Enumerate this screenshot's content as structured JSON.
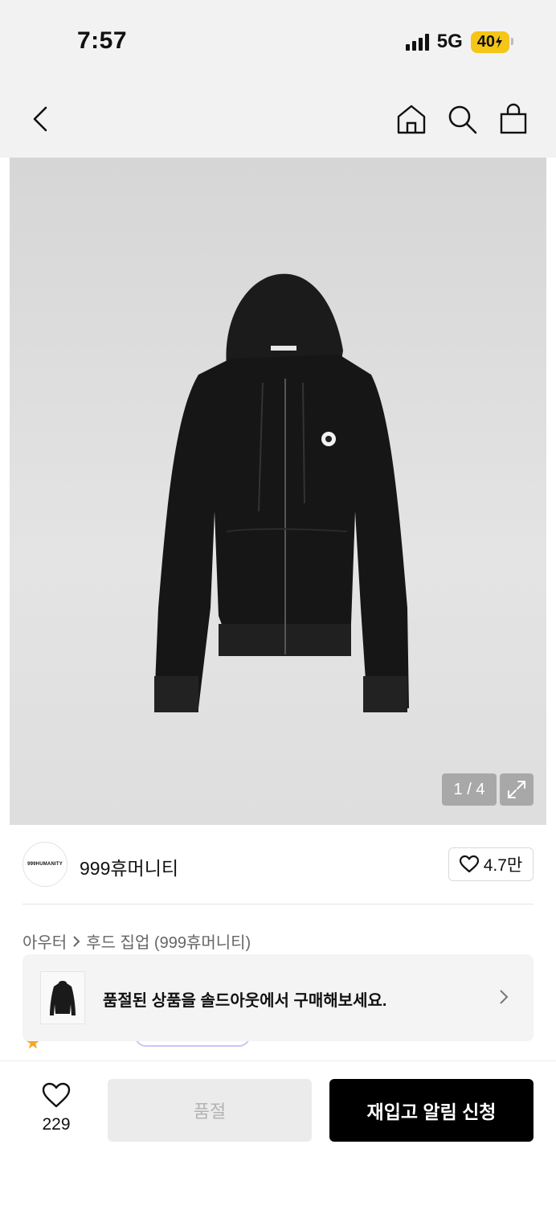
{
  "status_bar": {
    "time": "7:57",
    "network": "5G",
    "battery": "40"
  },
  "nav": {
    "back_icon": "chevron-left-icon",
    "home_icon": "home-icon",
    "search_icon": "search-icon",
    "bag_icon": "shopping-bag-icon"
  },
  "gallery": {
    "pager": "1 / 4",
    "expand_icon": "expand-icon"
  },
  "brand": {
    "logo_text": "999HUMANITY",
    "name": "999휴머니티",
    "likes": "4.7만"
  },
  "breadcrumb": {
    "category": "아우터",
    "subcategory": "후드 집업 (999휴머니티)"
  },
  "soldout_banner": {
    "text": "품절된 상품을 솔드아웃에서 구매해보세요."
  },
  "bottom_bar": {
    "wish_count": "229",
    "soldout_label": "품절",
    "restock_label": "재입고 알림 신청"
  },
  "colors": {
    "accent": "#000000",
    "battery": "#f5c518",
    "disabled_bg": "#ebebeb"
  }
}
